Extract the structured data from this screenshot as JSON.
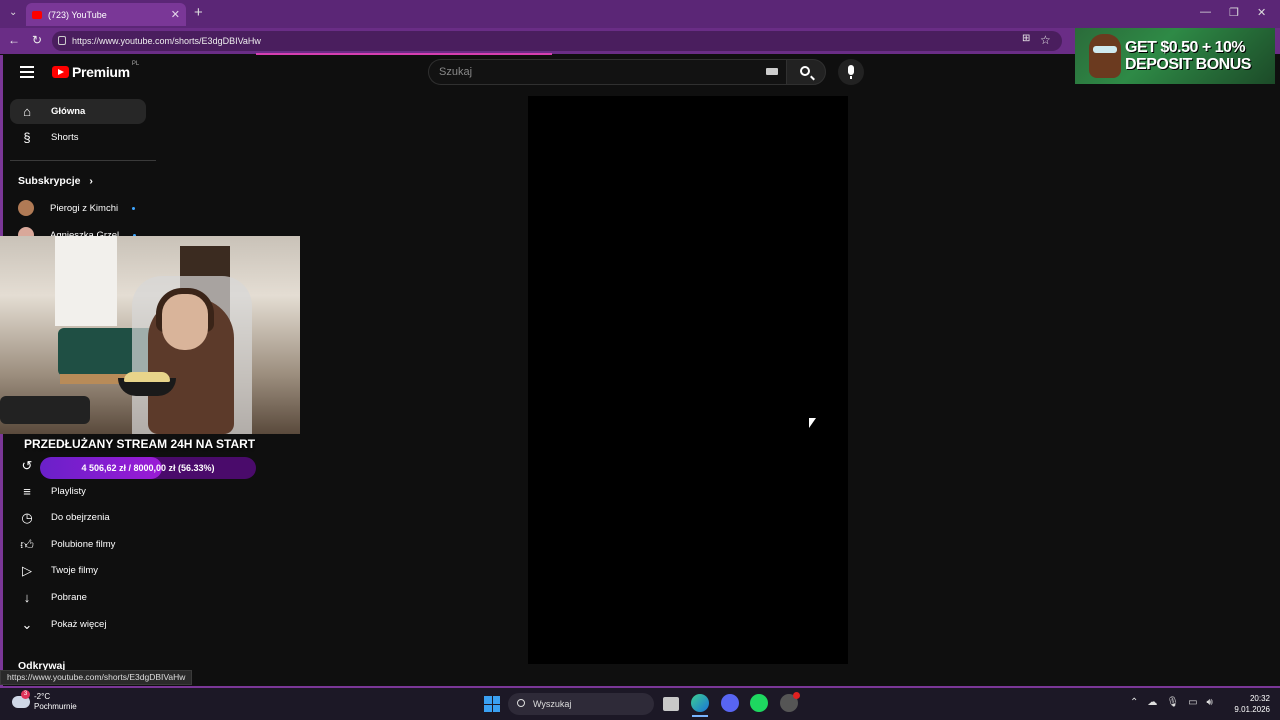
{
  "browser": {
    "tab_title": "(723) YouTube",
    "url": "https://www.youtube.com/shorts/E3dgDBIVaHw",
    "status_url": "https://www.youtube.com/shorts/E3dgDBIVaHw"
  },
  "youtube": {
    "logo_text": "Premium",
    "logo_region": "PL",
    "search_placeholder": "Szukaj",
    "sidebar": {
      "main_items": [
        {
          "label": "Główna",
          "icon": "home-icon"
        },
        {
          "label": "Shorts",
          "icon": "shorts-icon"
        }
      ],
      "subscriptions_title": "Subskrypcje",
      "channels": [
        {
          "name": "Pierogi z Kimchi"
        },
        {
          "name": "Agnieszka Grzel"
        }
      ],
      "you_items": [
        {
          "label": "Playlisty",
          "icon": "playlist-icon"
        },
        {
          "label": "Do obejrzenia",
          "icon": "watch-later-icon"
        },
        {
          "label": "Polubione filmy",
          "icon": "thumbs-up-icon"
        },
        {
          "label": "Twoje filmy",
          "icon": "your-videos-icon"
        },
        {
          "label": "Pobrane",
          "icon": "download-icon"
        },
        {
          "label": "Pokaż więcej",
          "icon": "chevron-down-icon"
        }
      ],
      "explore_title": "Odkrywaj"
    }
  },
  "ad": {
    "line1": "GET $0.50 + 10%",
    "line2": "DEPOSIT BONUS"
  },
  "stream_overlay": {
    "title": "PRZEDŁUŻANY STREAM 24H NA START",
    "goal_text": "4 506,62 zł / 8000,00 zł (56.33%)",
    "goal_progress": 0.5633
  },
  "taskbar": {
    "weather_temp": "-2°C",
    "weather_desc": "Pochmurnie",
    "weather_badge": "3",
    "search_label": "Wyszukaj",
    "time": "20:32",
    "date": "9.01.2026"
  },
  "colors": {
    "browser_accent": "#5b2676",
    "yt_red": "#ff0000",
    "goal_fill": "#9b1bd6"
  }
}
